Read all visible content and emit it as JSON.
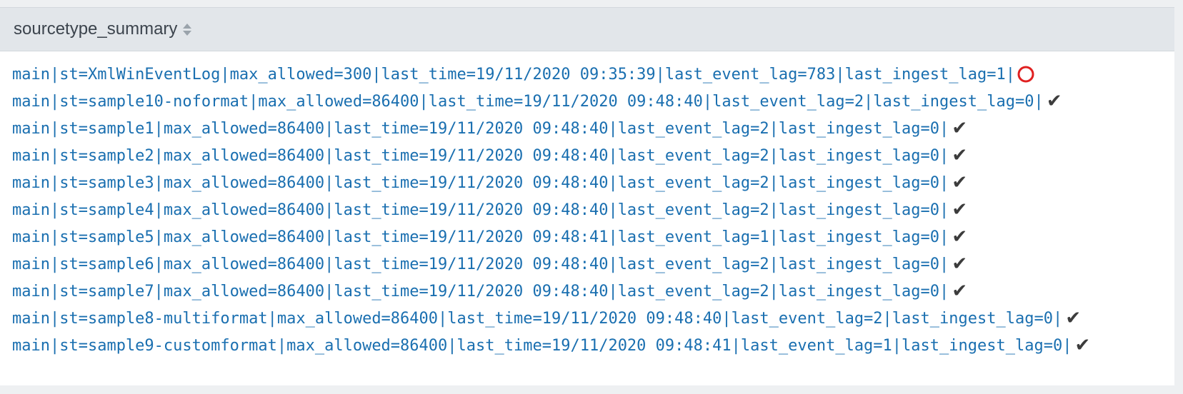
{
  "table": {
    "column_header": "sourcetype_summary",
    "colors": {
      "link": "#1a6fb0",
      "bad": "#e02020",
      "ok": "#3c3c3c"
    },
    "rows": [
      {
        "text": "main|st=XmlWinEventLog|max_allowed=300|last_time=19/11/2020 09:35:39|last_event_lag=783|last_ingest_lag=1|",
        "status": "circle-icon"
      },
      {
        "text": "main|st=sample10-noformat|max_allowed=86400|last_time=19/11/2020 09:48:40|last_event_lag=2|last_ingest_lag=0|",
        "status": "check-icon"
      },
      {
        "text": "main|st=sample1|max_allowed=86400|last_time=19/11/2020 09:48:40|last_event_lag=2|last_ingest_lag=0|",
        "status": "check-icon"
      },
      {
        "text": "main|st=sample2|max_allowed=86400|last_time=19/11/2020 09:48:40|last_event_lag=2|last_ingest_lag=0|",
        "status": "check-icon"
      },
      {
        "text": "main|st=sample3|max_allowed=86400|last_time=19/11/2020 09:48:40|last_event_lag=2|last_ingest_lag=0|",
        "status": "check-icon"
      },
      {
        "text": "main|st=sample4|max_allowed=86400|last_time=19/11/2020 09:48:40|last_event_lag=2|last_ingest_lag=0|",
        "status": "check-icon"
      },
      {
        "text": "main|st=sample5|max_allowed=86400|last_time=19/11/2020 09:48:41|last_event_lag=1|last_ingest_lag=0|",
        "status": "check-icon"
      },
      {
        "text": "main|st=sample6|max_allowed=86400|last_time=19/11/2020 09:48:40|last_event_lag=2|last_ingest_lag=0|",
        "status": "check-icon"
      },
      {
        "text": "main|st=sample7|max_allowed=86400|last_time=19/11/2020 09:48:40|last_event_lag=2|last_ingest_lag=0|",
        "status": "check-icon"
      },
      {
        "text": "main|st=sample8-multiformat|max_allowed=86400|last_time=19/11/2020 09:48:40|last_event_lag=2|last_ingest_lag=0|",
        "status": "check-icon"
      },
      {
        "text": "main|st=sample9-customformat|max_allowed=86400|last_time=19/11/2020 09:48:41|last_event_lag=1|last_ingest_lag=0|",
        "status": "check-icon"
      }
    ]
  }
}
